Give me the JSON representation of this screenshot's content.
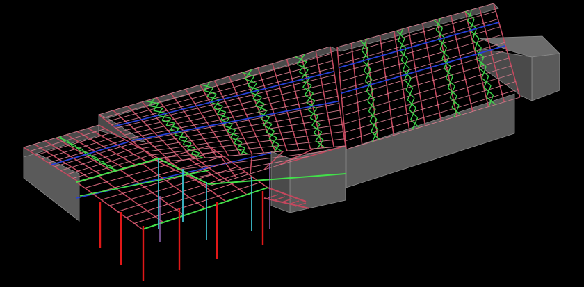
{
  "scene": {
    "background": "#000000",
    "colors": {
      "wall_face": "#5a5a5a",
      "wall_dark": "#4a4a4a",
      "wall_light": "#6c6c6c",
      "wall_edge": "#8a8a8a",
      "truss": "#c4485e",
      "truss_light": "#d86a7e",
      "purlin": "#cf7c8c",
      "brace": "#3ed44a",
      "beam_blue": "#2640d8",
      "beam_green": "#42e04a",
      "column_red": "#e01818",
      "column_cyan": "#3cc0d0",
      "column_violet": "#9c6cc0"
    }
  }
}
